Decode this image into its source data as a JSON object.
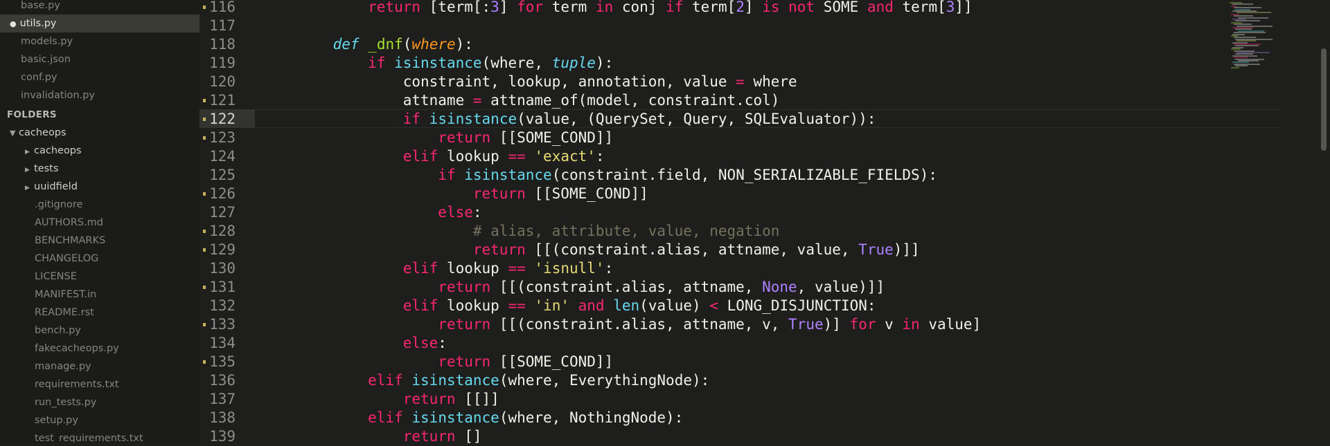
{
  "sidebar": {
    "open_files": [
      {
        "label": "base.py",
        "active": false,
        "dirty": false
      },
      {
        "label": "utils.py",
        "active": true,
        "dirty": true,
        "dirty_mark": "●"
      },
      {
        "label": "models.py",
        "active": false,
        "dirty": false
      },
      {
        "label": "basic.json",
        "active": false,
        "dirty": false
      },
      {
        "label": "conf.py",
        "active": false,
        "dirty": false
      },
      {
        "label": "invalidation.py",
        "active": false,
        "dirty": false
      }
    ],
    "folders_header": "FOLDERS",
    "root_folder": {
      "label": "cacheops",
      "expanded": true,
      "arrow": "▼"
    },
    "subfolders": [
      {
        "label": "cacheops",
        "arrow": "▶"
      },
      {
        "label": "tests",
        "arrow": "▶"
      },
      {
        "label": "uuidfield",
        "arrow": "▶"
      }
    ],
    "root_files": [
      ".gitignore",
      "AUTHORS.md",
      "BENCHMARKS",
      "CHANGELOG",
      "LICENSE",
      "MANIFEST.in",
      "README.rst",
      "bench.py",
      "fakecacheops.py",
      "manage.py",
      "requirements.txt",
      "run_tests.py",
      "setup.py",
      "test_requirements.txt"
    ]
  },
  "editor": {
    "current_line": "122",
    "line_numbers": [
      "116",
      "117",
      "118",
      "119",
      "120",
      "121",
      "122",
      "123",
      "124",
      "125",
      "126",
      "127",
      "128",
      "129",
      "130",
      "131",
      "132",
      "133",
      "134",
      "135",
      "136",
      "137",
      "138",
      "139"
    ],
    "modified_lines": [
      "116",
      "121",
      "122",
      "123",
      "126",
      "128",
      "129",
      "131",
      "133",
      "135"
    ],
    "code_lines": [
      "        return [term[:3] for term in conj if term[2] is not SOME and term[3]]",
      "",
      "    def _dnf(where):",
      "        if isinstance(where, tuple):",
      "            constraint, lookup, annotation, value = where",
      "            attname = attname_of(model, constraint.col)",
      "            if isinstance(value, (QuerySet, Query, SQLEvaluator)):",
      "                return [[SOME_COND]]",
      "            elif lookup == 'exact':",
      "                if isinstance(constraint.field, NON_SERIALIZABLE_FIELDS):",
      "                    return [[SOME_COND]]",
      "                else:",
      "                    # alias, attribute, value, negation",
      "                    return [[(constraint.alias, attname, value, True)]]",
      "            elif lookup == 'isnull':",
      "                return [[(constraint.alias, attname, None, value)]]",
      "            elif lookup == 'in' and len(value) < LONG_DISJUNCTION:",
      "                return [[(constraint.alias, attname, v, True)] for v in value]",
      "            else:",
      "                return [[SOME_COND]]",
      "        elif isinstance(where, EverythingNode):",
      "            return [[]]",
      "        elif isinstance(where, NothingNode):",
      "            return []"
    ]
  },
  "theme": {
    "keyword": "#f92672",
    "builtin": "#66d9ef",
    "function": "#a6e22e",
    "param": "#fd971f",
    "string": "#e6db74",
    "comment": "#75715e",
    "constant": "#ae81ff",
    "text": "#f1f1ea",
    "sidebar_bg": "#1b1c18",
    "editor_bg": "#1e1f1c",
    "gutter_mark": "#c9b35a"
  }
}
